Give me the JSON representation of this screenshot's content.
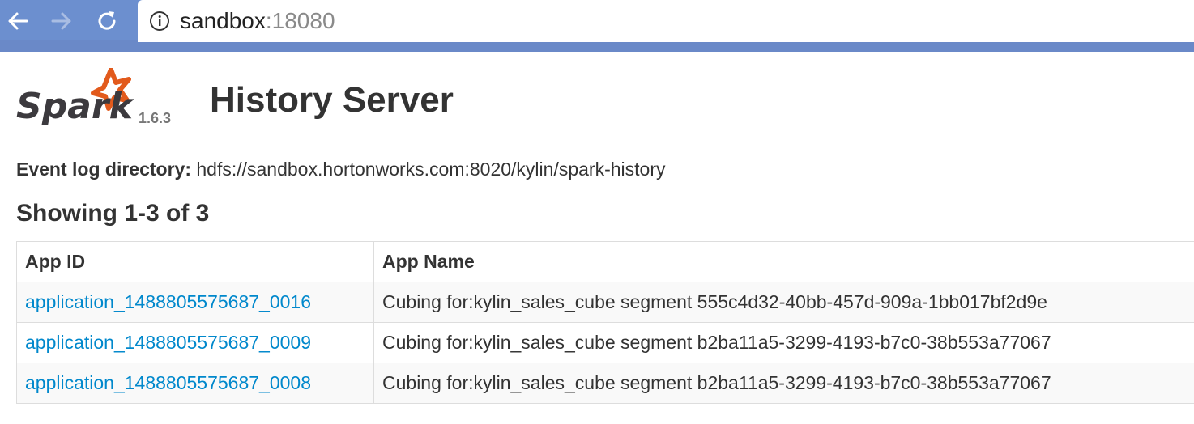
{
  "browser": {
    "back_icon": "arrow-left-icon",
    "forward_icon": "arrow-right-icon",
    "reload_icon": "reload-icon",
    "info_icon": "info-circle-icon",
    "url_host": "sandbox",
    "url_port": ":18080",
    "chrome_color": "#6c8fcf"
  },
  "header": {
    "logo_text": "Spark",
    "logo_star_color": "#e25a1c",
    "version": "1.6.3",
    "title": "History Server"
  },
  "event_log": {
    "label": "Event log directory:",
    "value": "hdfs://sandbox.hortonworks.com:8020/kylin/spark-history"
  },
  "showing": "Showing 1-3 of 3",
  "table": {
    "columns": [
      "App ID",
      "App Name"
    ],
    "rows": [
      {
        "app_id": "application_1488805575687_0016",
        "app_name": "Cubing for:kylin_sales_cube segment 555c4d32-40bb-457d-909a-1bb017bf2d9e"
      },
      {
        "app_id": "application_1488805575687_0009",
        "app_name": "Cubing for:kylin_sales_cube segment b2ba11a5-3299-4193-b7c0-38b553a77067"
      },
      {
        "app_id": "application_1488805575687_0008",
        "app_name": "Cubing for:kylin_sales_cube segment b2ba11a5-3299-4193-b7c0-38b553a77067"
      }
    ],
    "link_color": "#0088cc"
  }
}
